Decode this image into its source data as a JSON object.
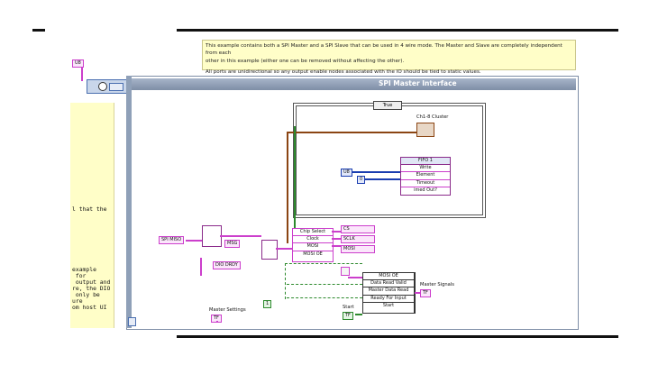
{
  "note": {
    "line1": "This example contains both a SPI Master and a SPI Slave that can be used in 4 wire mode. The Master and Slave are completely independent from each",
    "line2": "other in this example (either one can be removed without affecting the other).",
    "line3": "All ports are unidirectional so any output enable nodes associated with the IO should be tied to static values."
  },
  "frame_title": "SPI Master Interface",
  "left_comment": {
    "line_top": "l that the",
    "lines_bottom": [
      "example",
      " for",
      " output and",
      "re, the DIO",
      " only be",
      "ure",
      "om host UI"
    ]
  },
  "case_selector": "True",
  "ch_cluster": "Ch1-8 Cluster",
  "fifo": {
    "header": "FIFO 1",
    "rows": [
      "Write",
      "Element",
      "Timeout",
      "imed Out?"
    ]
  },
  "consts": {
    "c1": "U8",
    "c2": "0",
    "spi_miso": "SPI MISO",
    "dio_drdy": "DIO DRDY",
    "msg": "MSG",
    "master_settings": "Master Settings",
    "start": "Start",
    "tf": "TF",
    "v1": "1",
    "top_left": "U8"
  },
  "cluster_rows": [
    "Chip Select",
    "Clock",
    "MOSI",
    "MOSI OE"
  ],
  "io_outputs": [
    "CS",
    "SCLK",
    "MOSI"
  ],
  "signals_rows": [
    "MOSI OE",
    "Data Read Valid",
    "Master Data Read",
    "Ready For Input",
    "Start"
  ],
  "master_signals": "Master Signals"
}
